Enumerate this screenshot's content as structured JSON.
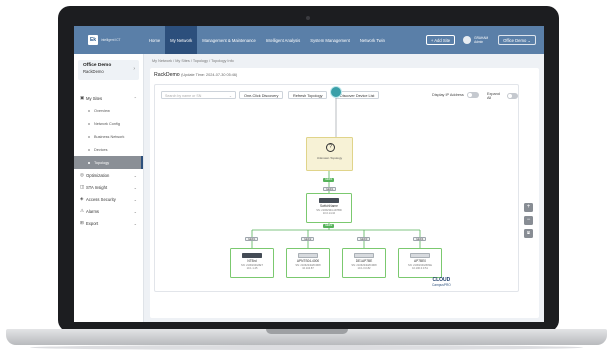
{
  "topbar": {
    "logo_mark": "Ek",
    "logo_text": "intelligent ICT",
    "nav": [
      "Home",
      "My Network",
      "Management & Maintenance",
      "Intelligent Analysis",
      "System Management",
      "Network Twin"
    ],
    "active_nav": "My Network",
    "add_site": "+ Add Site",
    "user_name": "GRAHAM",
    "user_role": "Admin",
    "office_select": "Office Demo"
  },
  "sidebar": {
    "site_name": "Office Demo",
    "site_sub": "RackDemo",
    "menu": {
      "my_sites": "My Sites",
      "overview": "Overview",
      "network_config": "Network Config",
      "business_network": "Business Network",
      "devices": "Devices",
      "topology": "Topology",
      "optimization": "Optimization",
      "sta_insight": "STA Insight",
      "access_security": "Access Security",
      "alarms": "Alarms",
      "export": "Export"
    }
  },
  "breadcrumb": "My Network / My Sites / Topology / Topology Info",
  "page": {
    "title": "RackDemo",
    "update_time": "(Update Time: 2024-07-30 05:46)"
  },
  "toolbar": {
    "search_placeholder": "Search by name or SN",
    "one_click": "One-Click Discovery",
    "refresh": "Refresh Topology",
    "discover": "Discover Device List",
    "display_ip": "Display IP Address",
    "expand_all": "Expand All"
  },
  "topology": {
    "internet_label": "Internet",
    "unknown_label": "Unknown Topology",
    "switch": {
      "name": "SwitchName",
      "sn": "SN: 2106234G1D7BD",
      "ip": "10.0.14.10",
      "up_port": "GE0/1",
      "down_port": "GE0/2"
    },
    "leaves": [
      {
        "name": "NTBrd",
        "sn": "SN: 2106234G8ET",
        "ip": "10.1.1.45",
        "port": "GE0/1",
        "icon": "dark"
      },
      {
        "name": "APNTS04-4000",
        "sn": "SN: 2106234G8C0D8",
        "ip": "10.104.87",
        "port": "GE0/2",
        "icon": "light"
      },
      {
        "name": "DE1AP7BE",
        "sn": "SN: 2106234G8C0D8",
        "ip": "10.1.0.0.82",
        "port": "GE0/3",
        "icon": "light"
      },
      {
        "name": "AP7BE0",
        "sn": "SN: 2106234G8DSE",
        "ip": "10.100.0.0.51",
        "port": "GE0/4",
        "icon": "light"
      }
    ],
    "link_badges": [
      "GE0/1",
      "GE0/2"
    ]
  },
  "zoom": {
    "in": "+",
    "out": "−",
    "fit": "⧈"
  },
  "brand": {
    "name": "CLOUD",
    "sub": "CampusPRO"
  },
  "colors": {
    "nav_bg": "#5a7fa8",
    "nav_active": "#2c4f7c",
    "link_green": "#56b35a",
    "unknown_bg": "#f7f2d6"
  }
}
